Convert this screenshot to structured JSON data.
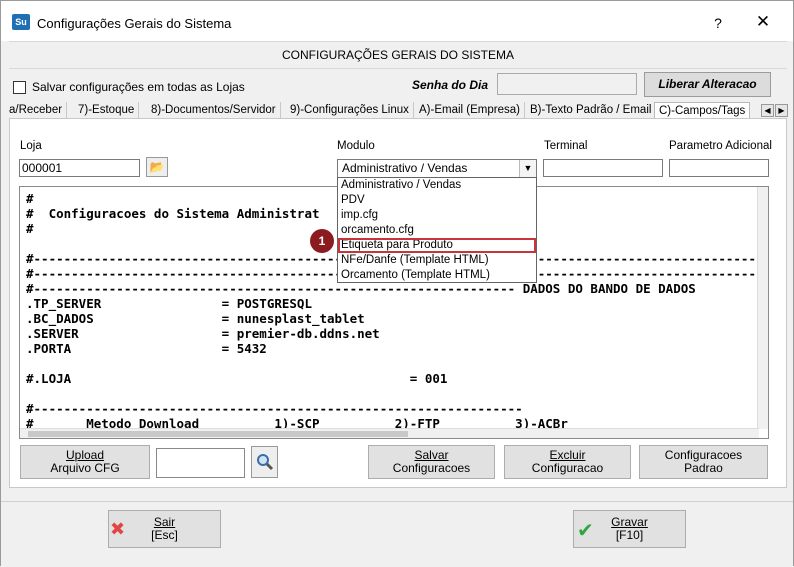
{
  "window": {
    "icon_text": "Su",
    "title": "Configurações Gerais do Sistema",
    "help": "?",
    "close": "✕"
  },
  "header": {
    "title": "CONFIGURAÇÕES GERAIS DO SISTEMA"
  },
  "top": {
    "save_all_label": "Salvar configurações em todas as Lojas",
    "senha_label": "Senha do Dia",
    "senha_value": "",
    "liberar_label": "Liberar Alteracao"
  },
  "tabs": [
    {
      "label": "a/Receber"
    },
    {
      "label": "7)-Estoque"
    },
    {
      "label": "8)-Documentos/Servidor"
    },
    {
      "label": "9)-Configurações Linux"
    },
    {
      "label": "A)-Email (Empresa)"
    },
    {
      "label": "B)-Texto Padrão / Email"
    },
    {
      "label": "C)-Campos/Tags"
    }
  ],
  "form": {
    "loja_label": "Loja",
    "loja_value": "000001",
    "modulo_label": "Modulo",
    "modulo_value": "Administrativo / Vendas",
    "terminal_label": "Terminal",
    "terminal_value": "",
    "param_label": "Parametro Adicional",
    "param_value": ""
  },
  "editor": {
    "text": "#\n#  Configuracoes do Sistema Administrat\n#\n\n#-----------------------------------------------------------------------------------------------------------\n#-----------------------------------------------------------------------------------------------------------\n#---------------------------------------------------------------- DADOS DO BANDO DE DADOS\n.TP_SERVER                = POSTGRESQL\n.BC_DADOS                 = nunesplast_tablet\n.SERVER                   = premier-db.ddns.net\n.PORTA                    = 5432\n\n#.LOJA                                             = 001\n\n#-----------------------------------------------------------------\n#       Metodo Download          1)-SCP          2)-FTP          3)-ACBr"
  },
  "dropdown": {
    "items": [
      "Administrativo / Vendas",
      "PDV",
      "imp.cfg",
      "orcamento.cfg",
      "Etiqueta para Produto",
      "NFe/Danfe (Template HTML)",
      "Orcamento (Template HTML)"
    ],
    "highlighted_index": 4,
    "marker": "1"
  },
  "actions": {
    "upload_line1": "Upload",
    "upload_line2": "Arquivo CFG",
    "search_value": "",
    "salvar_line1": "Salvar",
    "salvar_line2": "Configuracoes",
    "excluir_line1": "Excluir",
    "excluir_line2": "Configuracao",
    "padrao_line1": "Configuracoes",
    "padrao_line2": "Padrao"
  },
  "footer": {
    "sair_line1": "Sair",
    "sair_line2": "[Esc]",
    "gravar_line1": "Gravar",
    "gravar_line2": "[F10]"
  },
  "colors": {
    "highlight_outline": "#c9343a",
    "marker_bg": "#8b1b1e",
    "sair_icon": "#e04646",
    "gravar_icon": "#2fa640"
  }
}
